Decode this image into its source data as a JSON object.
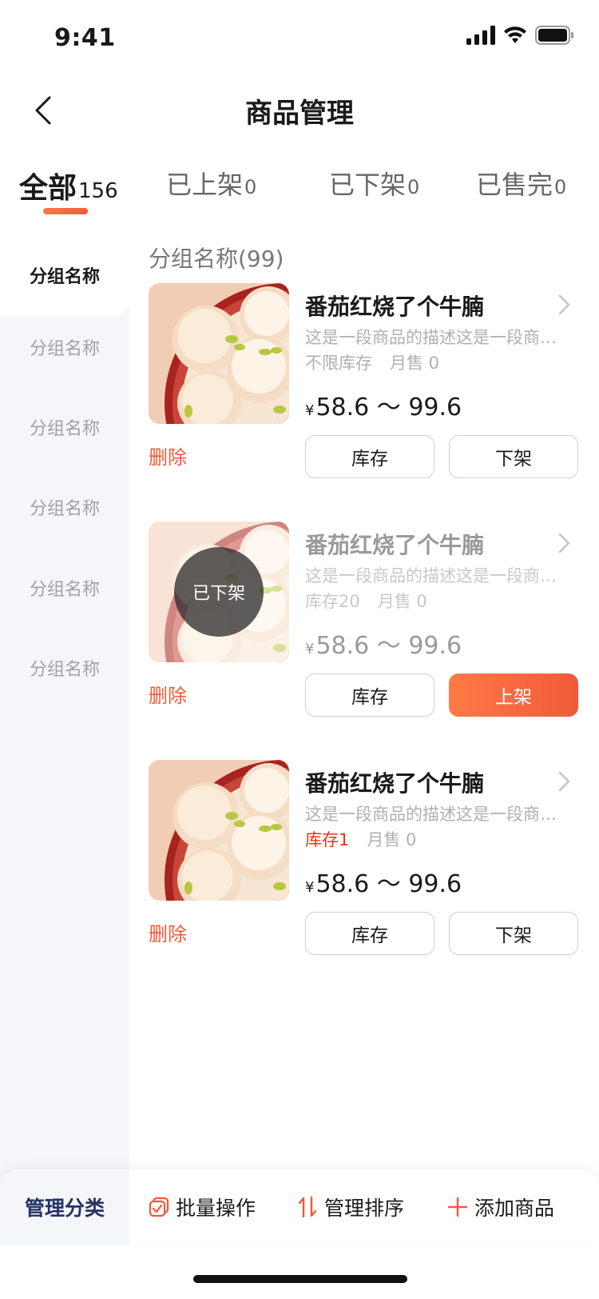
{
  "status_bar": {
    "time": "9:41"
  },
  "nav": {
    "title": "商品管理"
  },
  "tabs": [
    {
      "label": "全部",
      "count": "156"
    },
    {
      "label": "已上架",
      "count": "0"
    },
    {
      "label": "已下架",
      "count": "0"
    },
    {
      "label": "已售完",
      "count": "0"
    }
  ],
  "sidebar": {
    "items": [
      "分组名称",
      "分组名称",
      "分组名称",
      "分组名称",
      "分组名称",
      "分组名称"
    ]
  },
  "group": {
    "title": "分组名称(99)"
  },
  "products": [
    {
      "name": "番茄红烧了个牛腩",
      "desc": "这是一段商品的描述这是一段商品的描述",
      "stock": "不限库存",
      "sales": "月售 0",
      "currency": "¥",
      "price": "58.6 ～ 99.6",
      "delete_label": "删除",
      "stock_btn": "库存",
      "toggle_btn": "下架",
      "status": "on"
    },
    {
      "name": "番茄红烧了个牛腩",
      "desc": "这是一段商品的描述这是一段商品的描述",
      "stock": "库存20",
      "sales": "月售 0",
      "currency": "¥",
      "price": "58.6 ～ 99.6",
      "delete_label": "删除",
      "stock_btn": "库存",
      "toggle_btn": "上架",
      "status": "off",
      "badge": "已下架"
    },
    {
      "name": "番茄红烧了个牛腩",
      "desc": "这是一段商品的描述这是一段商品的描述",
      "stock": "库存1",
      "sales": "月售 0",
      "currency": "¥",
      "price": "58.6 ～ 99.6",
      "delete_label": "删除",
      "stock_btn": "库存",
      "toggle_btn": "下架",
      "status": "on",
      "low_stock": true
    }
  ],
  "bottom_bar": {
    "manage_category": "管理分类",
    "batch": "批量操作",
    "sort": "管理排序",
    "add": "添加商品"
  },
  "colors": {
    "accent": "#f05a3a",
    "accent_light": "#ff7a45",
    "nav_blue": "#233267",
    "warn_red": "#e8321a"
  },
  "icons": [
    "back-icon",
    "signal-icon",
    "wifi-icon",
    "battery-icon",
    "chevron-right-icon",
    "batch-icon",
    "sort-icon",
    "plus-icon"
  ]
}
